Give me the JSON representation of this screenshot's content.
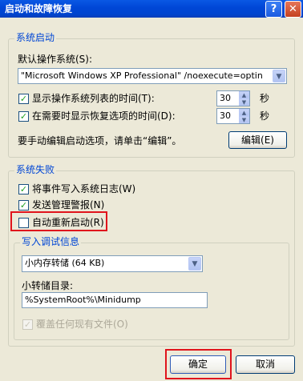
{
  "window": {
    "title": "启动和故障恢复",
    "help_glyph": "?",
    "close_glyph": "✕"
  },
  "system_startup": {
    "group_label": "系统启动",
    "default_os_label": "默认操作系统(S):",
    "default_os_value": "\"Microsoft Windows XP Professional\" /noexecute=optin",
    "show_os_list": {
      "label": "显示操作系统列表的时间(T):",
      "checked": true,
      "value": "30",
      "unit": "秒"
    },
    "show_recovery": {
      "label": "在需要时显示恢复选项的时间(D):",
      "checked": true,
      "value": "30",
      "unit": "秒"
    },
    "edit_hint": "要手动编辑启动选项，请单击“编辑”。",
    "edit_button": "编辑(E)"
  },
  "system_failure": {
    "group_label": "系统失败",
    "write_event": {
      "label": "将事件写入系统日志(W)",
      "checked": true
    },
    "send_alert": {
      "label": "发送管理警报(N)",
      "checked": true
    },
    "auto_restart": {
      "label": "自动重新启动(R)",
      "checked": false
    }
  },
  "debug_info": {
    "group_label": "写入调试信息",
    "dump_type": "小内存转储 (64 KB)",
    "dump_dir_label": "小转储目录:",
    "dump_dir_value": "%SystemRoot%\\Minidump",
    "overwrite": {
      "label": "覆盖任何现有文件(O)",
      "checked": true,
      "disabled": true
    }
  },
  "footer": {
    "ok_button": "确定",
    "cancel_button": "取消"
  },
  "glyphs": {
    "check": "✓",
    "arrow_down": "▼",
    "arrow_up": "▲"
  },
  "colors": {
    "title_bar": "#0046d6",
    "group_label": "#0046d5",
    "highlight_box": "#e0141c",
    "dialog_bg": "#ece9d8"
  }
}
